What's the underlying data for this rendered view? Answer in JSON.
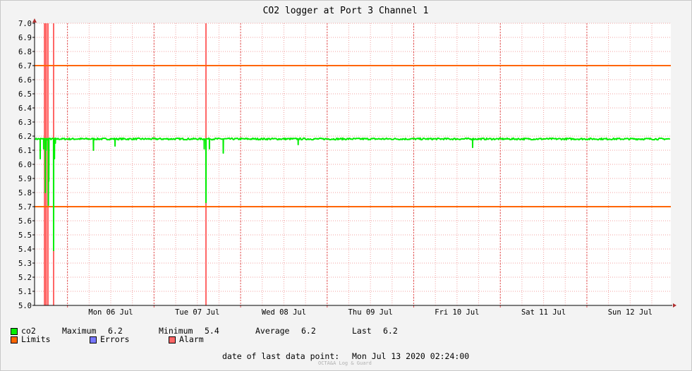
{
  "chart_data": {
    "type": "line",
    "title": "CO2 logger at Port 3 Channel 1",
    "ylim": [
      5.0,
      7.0
    ],
    "y_ticks": [
      "7.0",
      "6.9",
      "6.8",
      "6.7",
      "6.6",
      "6.5",
      "6.4",
      "6.3",
      "6.2",
      "6.1",
      "6.0",
      "5.9",
      "5.8",
      "5.7",
      "5.6",
      "5.5",
      "5.4",
      "5.3",
      "5.2",
      "5.1",
      "5.0"
    ],
    "x_ticks": [
      "Mon 06 Jul",
      "Tue 07 Jul",
      "Wed 08 Jul",
      "Thu 09 Jul",
      "Fri 10 Jul",
      "Sat 11 Jul",
      "Sun 12 Jul"
    ],
    "xlim_days": [
      5.62,
      12.97
    ],
    "grid": true,
    "limits": [
      6.7,
      5.7
    ],
    "alarm_markers_day": [
      5.735,
      5.745,
      5.755,
      5.775,
      5.84,
      7.6
    ],
    "series": [
      {
        "name": "co2",
        "color": "#00ee00",
        "baseline": 6.18,
        "dips": [
          {
            "x": 5.685,
            "y": 6.04
          },
          {
            "x": 5.725,
            "y": 6.11
          },
          {
            "x": 5.745,
            "y": 5.8
          },
          {
            "x": 5.755,
            "y": 6.1
          },
          {
            "x": 5.78,
            "y": 5.71
          },
          {
            "x": 5.785,
            "y": 5.88
          },
          {
            "x": 5.84,
            "y": 5.39
          },
          {
            "x": 5.85,
            "y": 6.04
          },
          {
            "x": 5.86,
            "y": 6.15
          },
          {
            "x": 6.3,
            "y": 6.1
          },
          {
            "x": 6.55,
            "y": 6.13
          },
          {
            "x": 7.58,
            "y": 6.11
          },
          {
            "x": 7.6,
            "y": 5.73
          },
          {
            "x": 7.64,
            "y": 6.11
          },
          {
            "x": 7.8,
            "y": 6.08
          },
          {
            "x": 8.665,
            "y": 6.14
          },
          {
            "x": 10.68,
            "y": 6.12
          }
        ]
      }
    ],
    "legend": {
      "series_label": "co2",
      "maximum_label": "Maximum",
      "maximum_value": "6.2",
      "minimum_label": "Minimum",
      "minimum_value": "5.4",
      "average_label": "Average",
      "average_value": "6.2",
      "last_label": "Last",
      "last_value": "6.2",
      "limits_label": "Limits",
      "limits_color": "#ff6600",
      "errors_label": "Errors",
      "errors_color": "#7777ff",
      "alarm_label": "Alarm",
      "alarm_color": "#ff6666"
    }
  },
  "footer": {
    "last_point_label": "date of last data point:",
    "last_point_value": "Mon Jul 13 2020 02:24:00",
    "watermark": "OCTA&A Log & Guard"
  }
}
